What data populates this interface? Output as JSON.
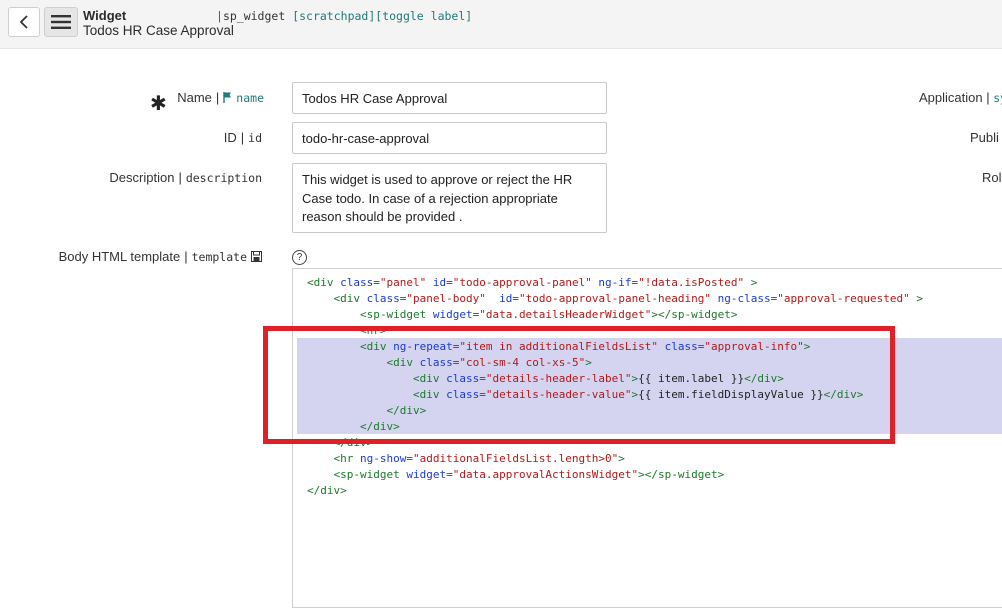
{
  "header": {
    "record_type": "Widget",
    "record_name": "Todos HR Case Approval",
    "separator": "|",
    "table_name": "sp_widget",
    "tags": "[scratchpad][toggle label]"
  },
  "form": {
    "name": {
      "label": "Name",
      "sep": "|",
      "field": "name",
      "value": "Todos HR Case Approval"
    },
    "id": {
      "label": "ID",
      "sep": "|",
      "field": "id",
      "value": "todo-hr-case-approval"
    },
    "description": {
      "label": "Description",
      "sep": "|",
      "field": "description",
      "value": "This widget is used to approve or reject the HR Case todo. In case of a rejection appropriate reason should be provided ."
    },
    "template": {
      "label": "Body HTML template",
      "sep": "|",
      "field": "template",
      "help": "?"
    },
    "right": {
      "application": "Application",
      "application_sep": "|",
      "application_field": "sy",
      "public": "Publi",
      "roles": "Rol"
    },
    "required_marker": "✱"
  },
  "code_lines": [
    {
      "indent": 0,
      "parts": [
        [
          "tag",
          "<div "
        ],
        [
          "attr",
          "class="
        ],
        [
          "str",
          "\"panel\""
        ],
        [
          "attr",
          " id="
        ],
        [
          "str",
          "\"todo-approval-panel\""
        ],
        [
          "attr",
          " ng-if="
        ],
        [
          "str",
          "\"!data.isPosted\""
        ],
        [
          "tag",
          " >"
        ]
      ]
    },
    {
      "indent": 4,
      "parts": [
        [
          "tag",
          "<div "
        ],
        [
          "attr",
          "class="
        ],
        [
          "str",
          "\"panel-body\""
        ],
        [
          "attr",
          "  id="
        ],
        [
          "str",
          "\"todo-approval-panel-heading\""
        ],
        [
          "attr",
          " ng-class="
        ],
        [
          "str",
          "\"approval-requested\""
        ],
        [
          "tag",
          " >"
        ]
      ]
    },
    {
      "indent": 8,
      "parts": [
        [
          "tag",
          "<sp-widget "
        ],
        [
          "attr",
          "widget="
        ],
        [
          "str",
          "\"data.detailsHeaderWidget\""
        ],
        [
          "tag",
          "></sp-widget>"
        ]
      ]
    },
    {
      "indent": 8,
      "parts": [
        [
          "tag",
          "<hr>"
        ]
      ]
    },
    {
      "indent": 8,
      "parts": [
        [
          "tag",
          "<div "
        ],
        [
          "attr",
          "ng-repeat="
        ],
        [
          "str",
          "\"item in additionalFieldsList\""
        ],
        [
          "attr",
          " class="
        ],
        [
          "str",
          "\"approval-info\""
        ],
        [
          "tag",
          ">"
        ]
      ]
    },
    {
      "indent": 12,
      "parts": [
        [
          "tag",
          "<div "
        ],
        [
          "attr",
          "class="
        ],
        [
          "str",
          "\"col-sm-4 col-xs-5\""
        ],
        [
          "tag",
          ">"
        ]
      ]
    },
    {
      "indent": 16,
      "parts": [
        [
          "tag",
          "<div "
        ],
        [
          "attr",
          "class="
        ],
        [
          "str",
          "\"details-header-label\""
        ],
        [
          "tag",
          ">"
        ],
        [
          "txt",
          "{{ item.label }}"
        ],
        [
          "tag",
          "</div>"
        ]
      ]
    },
    {
      "indent": 16,
      "parts": [
        [
          "tag",
          "<div "
        ],
        [
          "attr",
          "class="
        ],
        [
          "str",
          "\"details-header-value\""
        ],
        [
          "tag",
          ">"
        ],
        [
          "txt",
          "{{ item.fieldDisplayValue }}"
        ],
        [
          "tag",
          "</div>"
        ]
      ]
    },
    {
      "indent": 12,
      "parts": [
        [
          "tag",
          "</div>"
        ]
      ]
    },
    {
      "indent": 8,
      "parts": [
        [
          "tag",
          "</div>"
        ]
      ]
    },
    {
      "indent": 4,
      "parts": [
        [
          "tag",
          "</div>"
        ]
      ]
    },
    {
      "indent": 4,
      "parts": [
        [
          "tag",
          "<hr "
        ],
        [
          "attr",
          "ng-show="
        ],
        [
          "str",
          "\"additionalFieldsList.length>0\""
        ],
        [
          "tag",
          ">"
        ]
      ]
    },
    {
      "indent": 4,
      "parts": [
        [
          "tag",
          "<sp-widget "
        ],
        [
          "attr",
          "widget="
        ],
        [
          "str",
          "\"data.approvalActionsWidget\""
        ],
        [
          "tag",
          "></sp-widget>"
        ]
      ]
    },
    {
      "indent": 0,
      "parts": [
        [
          "tag",
          "</div>"
        ]
      ]
    }
  ]
}
